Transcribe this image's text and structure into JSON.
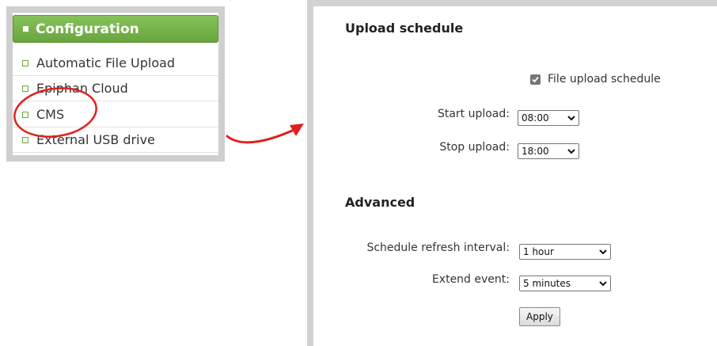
{
  "sidebar": {
    "header": "Configuration",
    "items": [
      {
        "label": "Automatic File Upload"
      },
      {
        "label": "Epiphan Cloud"
      },
      {
        "label": "CMS"
      },
      {
        "label": "External USB drive"
      }
    ]
  },
  "upload_schedule": {
    "title": "Upload schedule",
    "checkbox_label": "File upload schedule",
    "checkbox_checked": true,
    "start_label": "Start upload:",
    "start_value": "08:00",
    "stop_label": "Stop upload:",
    "stop_value": "18:00"
  },
  "advanced": {
    "title": "Advanced",
    "refresh_label": "Schedule refresh interval:",
    "refresh_value": "1 hour",
    "extend_label": "Extend event:",
    "extend_value": "5 minutes",
    "apply_label": "Apply"
  },
  "colors": {
    "accent_green": "#6aa43e",
    "annotation_red": "#e0201d",
    "frame_gray": "#d2d2d2"
  }
}
